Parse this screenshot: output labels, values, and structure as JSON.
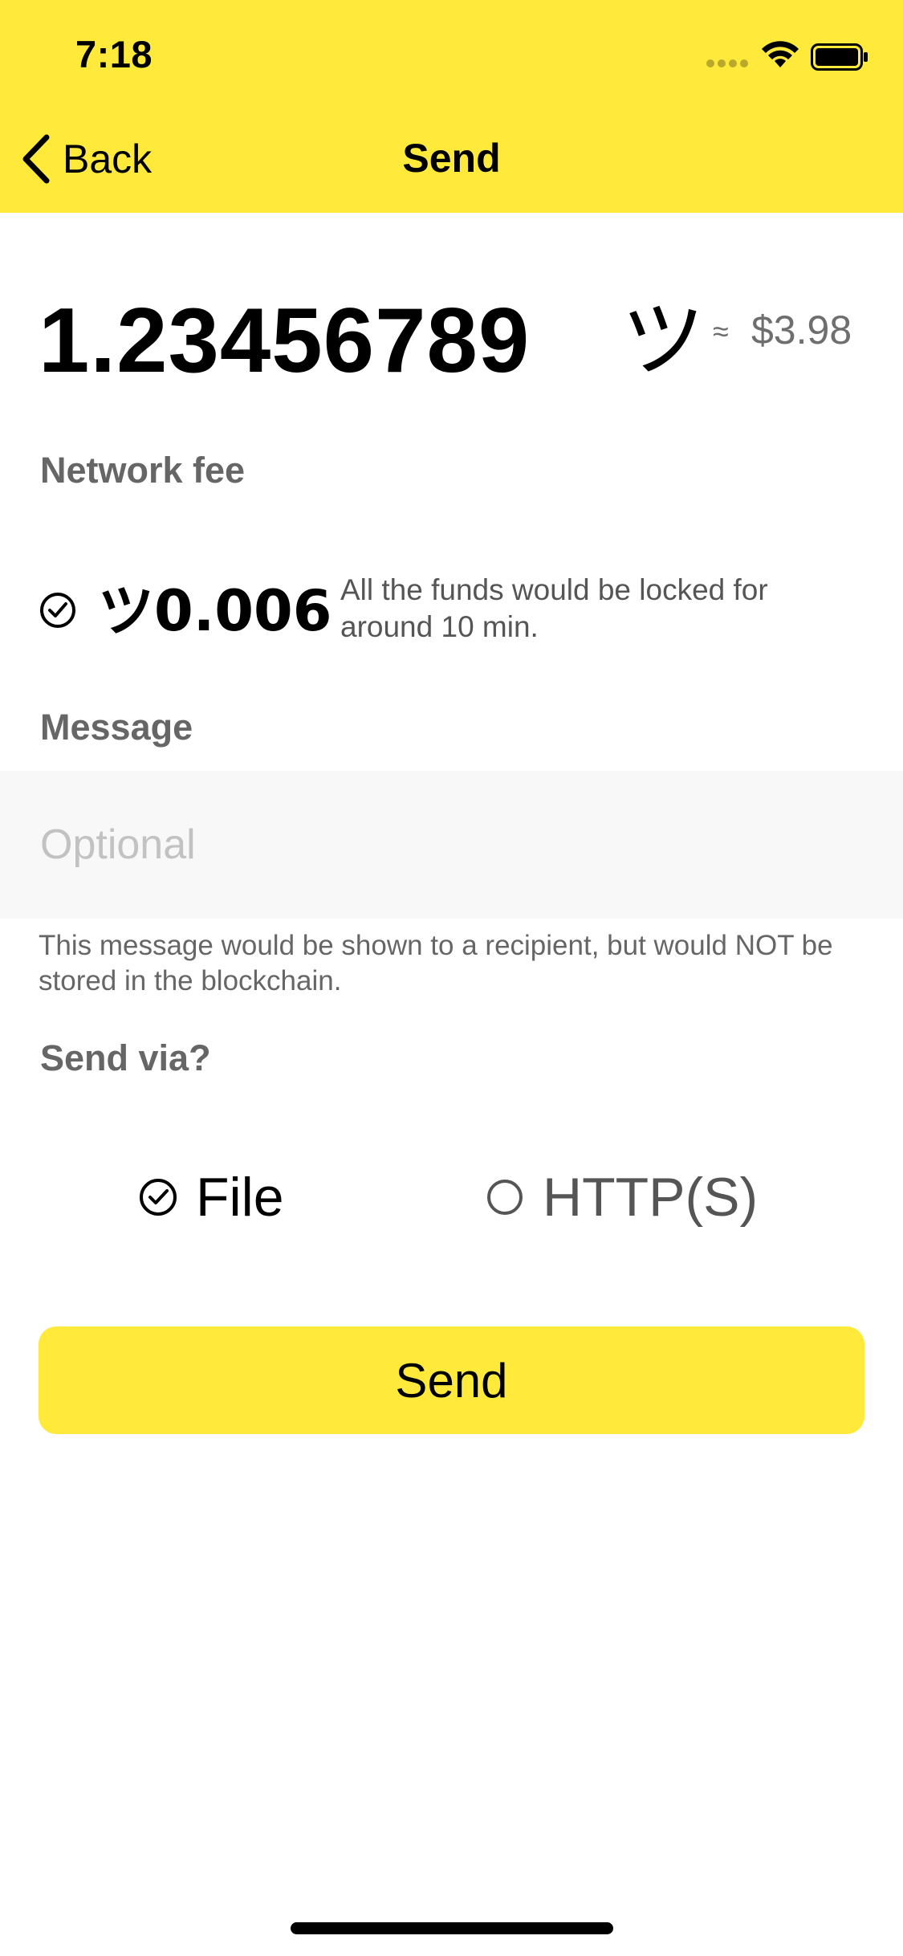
{
  "status_bar": {
    "time": "7:18"
  },
  "nav": {
    "back_label": "Back",
    "title": "Send"
  },
  "amount": {
    "value": "1.23456789",
    "currency_symbol": "ツ",
    "approx_symbol": "≈",
    "fiat_value": "$3.98"
  },
  "network_fee": {
    "label": "Network fee",
    "amount": "ツ0.006",
    "note": "All the funds would be locked for around 10 min.",
    "selected": true
  },
  "message": {
    "label": "Message",
    "value": "",
    "placeholder": "Optional",
    "hint": "This message would be shown to a recipient, but would NOT be stored in the blockchain."
  },
  "send_via": {
    "label": "Send via?",
    "options": [
      {
        "label": "File",
        "selected": true
      },
      {
        "label": "HTTP(S)",
        "selected": false
      }
    ]
  },
  "send_button": {
    "label": "Send"
  },
  "colors": {
    "accent": "#ffea3b",
    "secondary_text": "#666666",
    "placeholder": "#c2c2c2",
    "input_background": "#f8f8f8"
  }
}
